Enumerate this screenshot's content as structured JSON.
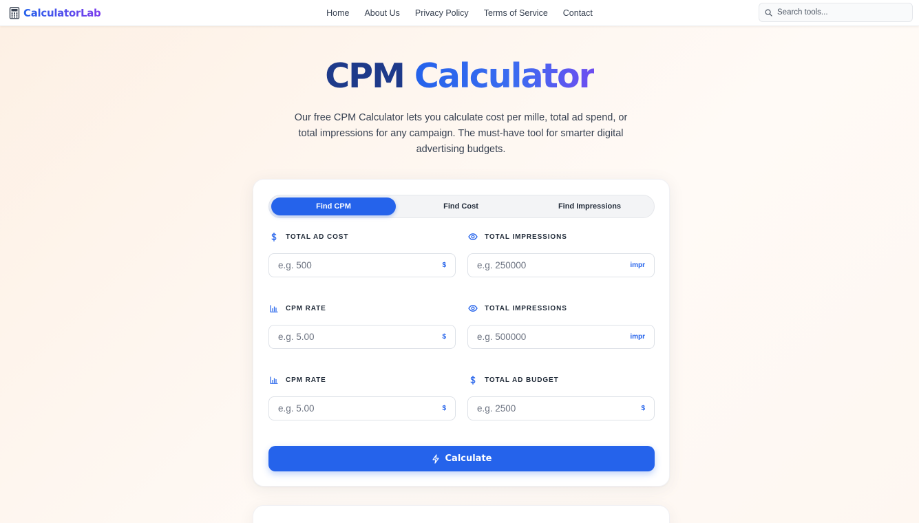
{
  "brand": {
    "name": "CalculatorLab"
  },
  "nav": {
    "items": [
      "Home",
      "About Us",
      "Privacy Policy",
      "Terms of Service",
      "Contact"
    ]
  },
  "search": {
    "placeholder": "Search tools..."
  },
  "hero": {
    "title_part1": "CPM",
    "title_part2": "Calculator",
    "description": "Our free CPM Calculator lets you calculate cost per mille, total ad spend, or total impressions for any campaign. The must-have tool for smarter digital advertising budgets."
  },
  "calculator": {
    "tabs": [
      {
        "label": "Find CPM",
        "active": true
      },
      {
        "label": "Find Cost",
        "active": false
      },
      {
        "label": "Find Impressions",
        "active": false
      }
    ],
    "fields": [
      {
        "label": "TOTAL AD COST",
        "icon": "dollar-icon",
        "placeholder": "e.g. 500",
        "unit": "$"
      },
      {
        "label": "TOTAL IMPRESSIONS",
        "icon": "eye-icon",
        "placeholder": "e.g. 250000",
        "unit": "impr"
      },
      {
        "label": "CPM RATE",
        "icon": "bar-chart-icon",
        "placeholder": "e.g. 5.00",
        "unit": "$"
      },
      {
        "label": "TOTAL IMPRESSIONS",
        "icon": "eye-icon",
        "placeholder": "e.g. 500000",
        "unit": "impr"
      },
      {
        "label": "CPM RATE",
        "icon": "bar-chart-icon",
        "placeholder": "e.g. 5.00",
        "unit": "$"
      },
      {
        "label": "TOTAL AD BUDGET",
        "icon": "dollar-icon",
        "placeholder": "e.g. 2500",
        "unit": "$"
      }
    ],
    "button_label": "Calculate"
  },
  "colors": {
    "accent": "#2563eb",
    "title_dark": "#1e3a8a",
    "brand_gradient_end": "#7c3aed"
  }
}
